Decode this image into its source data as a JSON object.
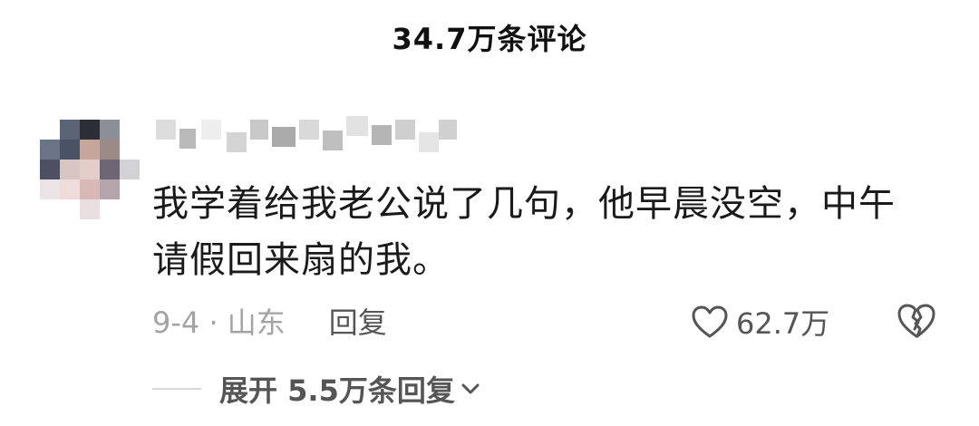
{
  "header": {
    "title": "34.7万条评论"
  },
  "comment": {
    "text_line1": "我学着给我老公说了几句，他早晨没空，中午",
    "text_line2": "请假回来扇的我。",
    "date_location": "9-4 · 山东",
    "reply_label": "回复",
    "like_count": "62.7万",
    "expand_label": "展开 5.5万条回复"
  },
  "icons": {
    "like": "heart-outline-icon",
    "dislike": "broken-heart-icon",
    "expand": "chevron-down-icon"
  }
}
